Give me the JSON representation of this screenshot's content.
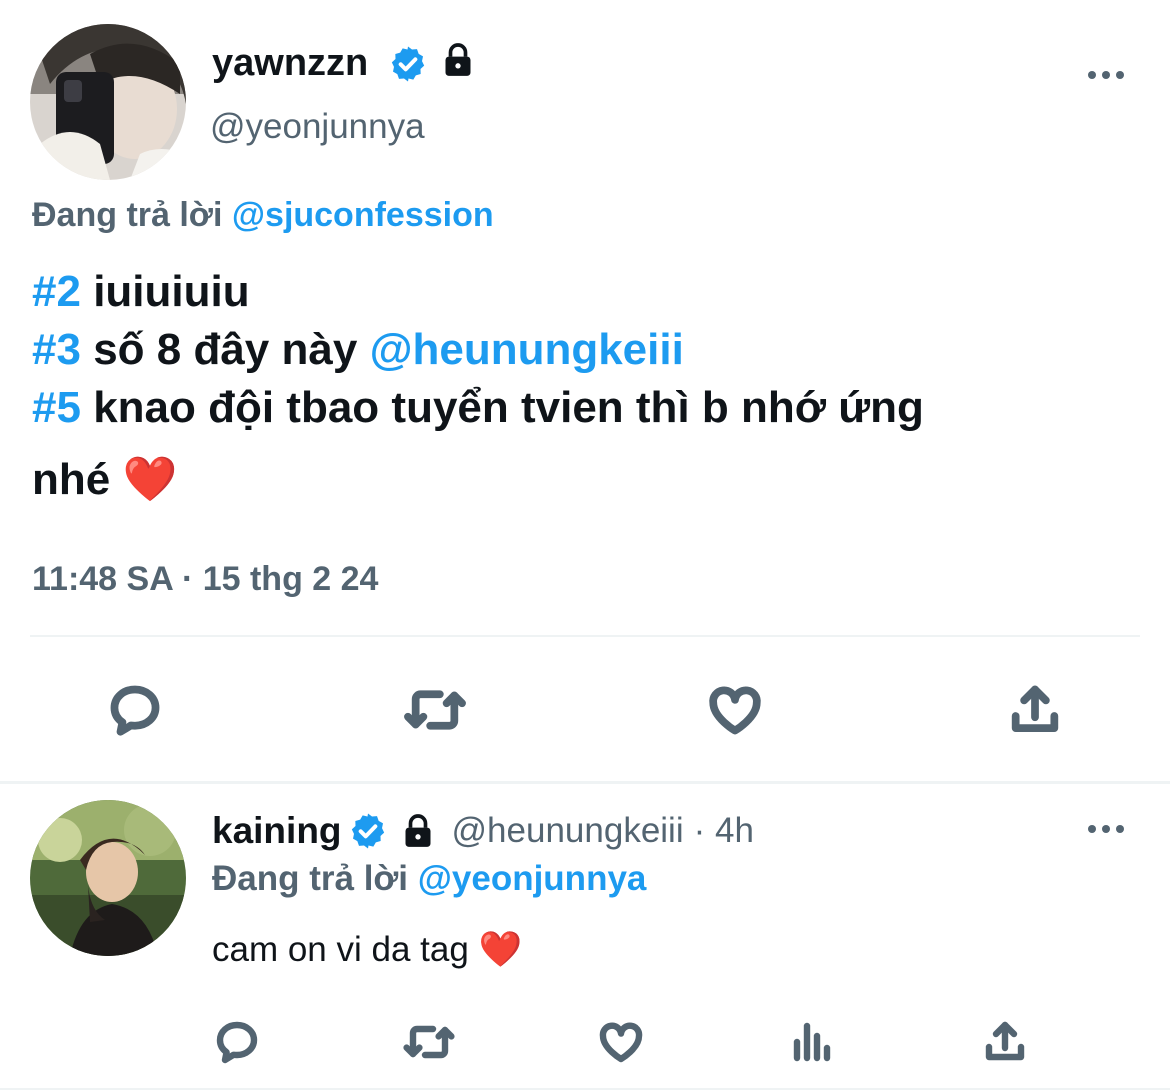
{
  "main_tweet": {
    "author": {
      "display_name": "yawnzzn",
      "handle": "@yeonjunnya",
      "verified_icon": "verified-badge-icon",
      "lock_icon": "lock-icon"
    },
    "replying": {
      "prefix": "Đang trả lời",
      "mention": "@sjuconfession"
    },
    "lines": [
      {
        "tag": "#2",
        "text": "iuiuiuiu",
        "mention": ""
      },
      {
        "tag": "#3",
        "text": "số 8 đây này",
        "mention": "@heunungkeiii"
      },
      {
        "tag": "#5",
        "text": "knao đội tbao tuyển tvien thì b nhớ ứng",
        "mention": ""
      }
    ],
    "last_line": "nhé",
    "emoji": "❤️",
    "timestamp": "11:48 SA · 15 thg 2 24",
    "actions": [
      "reply-icon",
      "retweet-icon",
      "like-icon",
      "share-icon"
    ]
  },
  "reply_tweet": {
    "author": {
      "display_name": "kaining",
      "handle": "@heunungkeiii",
      "time": "· 4h"
    },
    "replying": {
      "prefix": "Đang trả lời",
      "mention": "@yeonjunnya"
    },
    "text": "cam on vi da tag",
    "emoji": "❤️",
    "actions": [
      "reply-icon",
      "retweet-icon",
      "like-icon",
      "analytics-icon",
      "share-icon"
    ]
  },
  "colors": {
    "accent": "#1d9bf0",
    "muted": "#536471",
    "text": "#0f1419",
    "divider": "#eff3f4"
  }
}
